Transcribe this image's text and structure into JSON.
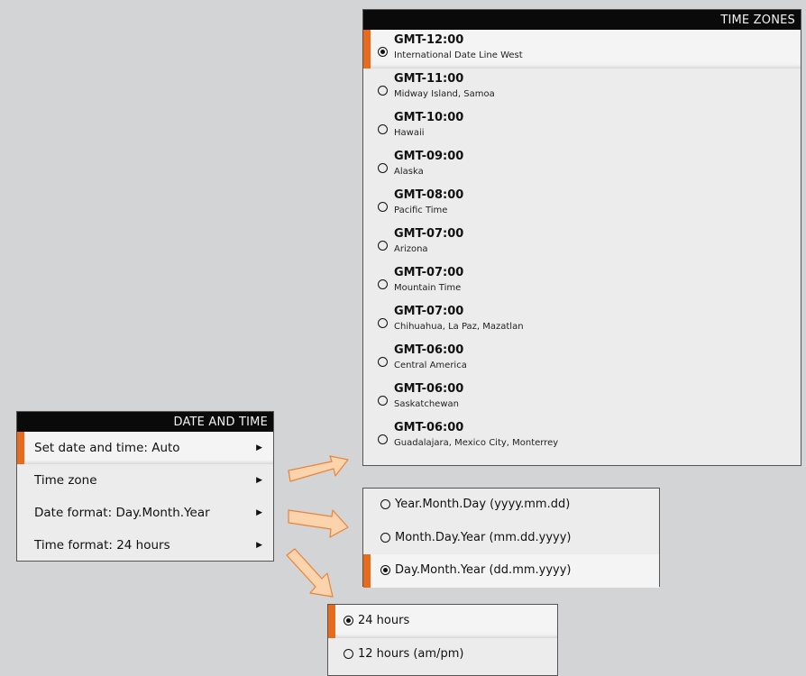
{
  "date_time_menu": {
    "title": "DATE AND TIME",
    "items": [
      {
        "label": "Set date and time: Auto",
        "selected": true
      },
      {
        "label": "Time zone",
        "selected": false
      },
      {
        "label": "Date format: Day.Month.Year",
        "selected": false
      },
      {
        "label": "Time format: 24 hours",
        "selected": false
      }
    ],
    "arrow_glyph": "▶"
  },
  "time_zones": {
    "title": "TIME ZONES",
    "items": [
      {
        "name": "GMT-12:00",
        "desc": "International Date Line West",
        "selected": true
      },
      {
        "name": "GMT-11:00",
        "desc": "Midway Island, Samoa",
        "selected": false
      },
      {
        "name": "GMT-10:00",
        "desc": "Hawaii",
        "selected": false
      },
      {
        "name": "GMT-09:00",
        "desc": "Alaska",
        "selected": false
      },
      {
        "name": "GMT-08:00",
        "desc": "Pacific Time",
        "selected": false
      },
      {
        "name": "GMT-07:00",
        "desc": "Arizona",
        "selected": false
      },
      {
        "name": "GMT-07:00",
        "desc": "Mountain Time",
        "selected": false
      },
      {
        "name": "GMT-07:00",
        "desc": "Chihuahua, La Paz, Mazatlan",
        "selected": false
      },
      {
        "name": "GMT-06:00",
        "desc": "Central America",
        "selected": false
      },
      {
        "name": "GMT-06:00",
        "desc": "Saskatchewan",
        "selected": false
      },
      {
        "name": "GMT-06:00",
        "desc": "Guadalajara, Mexico City, Monterrey",
        "selected": false
      }
    ]
  },
  "date_format_options": [
    {
      "label": "Year.Month.Day (yyyy.mm.dd)",
      "selected": false
    },
    {
      "label": "Month.Day.Year (mm.dd.yyyy)",
      "selected": false
    },
    {
      "label": "Day.Month.Year (dd.mm.yyyy)",
      "selected": true
    }
  ],
  "time_format_options": [
    {
      "label": "24 hours",
      "selected": true
    },
    {
      "label": "12 hours (am/pm)",
      "selected": false
    }
  ],
  "colors": {
    "accent": "#e86a1c",
    "arrow_fill": "#fbd3ad",
    "arrow_stroke": "#e8843a",
    "header_bg": "#0a0a0a",
    "panel_bg": "#ececec",
    "page_bg": "#d3d4d5"
  }
}
